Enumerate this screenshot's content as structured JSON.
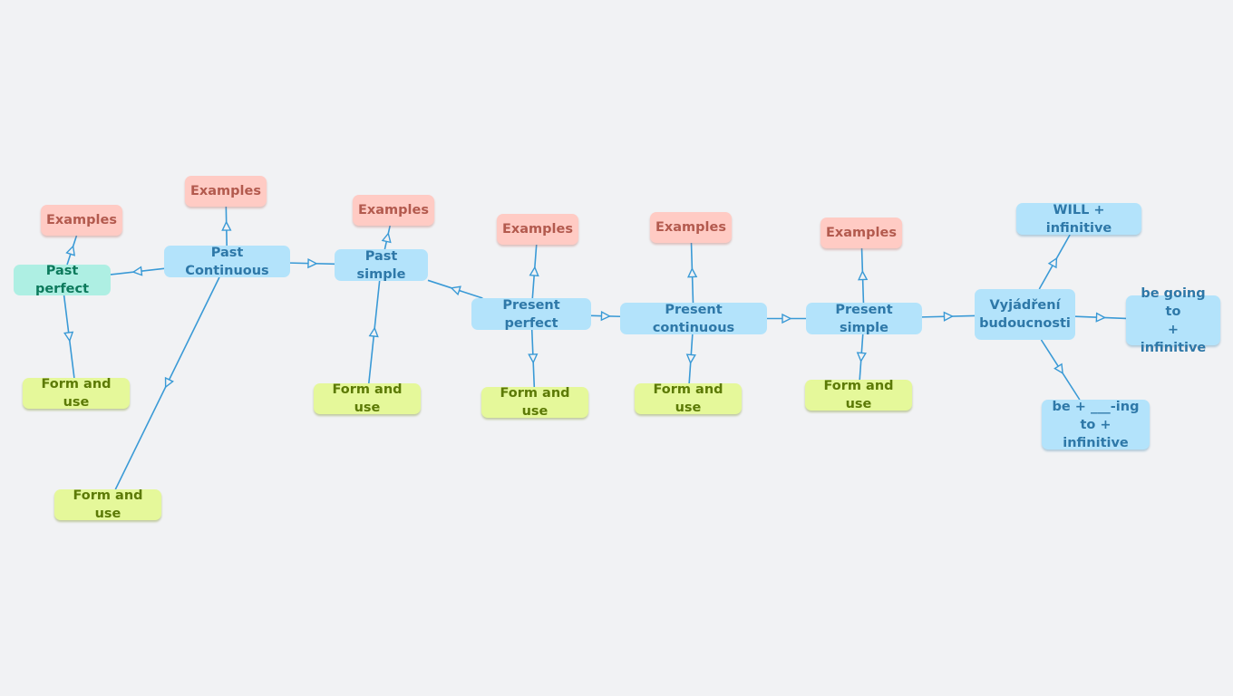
{
  "diagram": {
    "type": "concept-map",
    "colors": {
      "background": "#f1f2f4",
      "edge": "#3a9ad6",
      "topic": "#b3e3fb",
      "topic_text": "#2e78a8",
      "past_perfect": "#aeefe3",
      "past_perfect_text": "#0d7a5c",
      "examples": "#ffcbc4",
      "examples_text": "#b35a4e",
      "form_and_use": "#e5f89a",
      "form_and_use_text": "#5c7a06"
    },
    "nodes": [
      {
        "id": "past-perfect",
        "label": "Past perfect",
        "kind": "past-perfect"
      },
      {
        "id": "past-perfect-examples",
        "label": "Examples",
        "kind": "example"
      },
      {
        "id": "past-perfect-form",
        "label": "Form and use",
        "kind": "form"
      },
      {
        "id": "past-continuous",
        "label": "Past Continuous",
        "kind": "topic"
      },
      {
        "id": "past-continuous-examples",
        "label": "Examples",
        "kind": "example"
      },
      {
        "id": "past-continuous-form",
        "label": "Form and use",
        "kind": "form"
      },
      {
        "id": "past-simple",
        "label": "Past simple",
        "kind": "topic"
      },
      {
        "id": "past-simple-examples",
        "label": "Examples",
        "kind": "example"
      },
      {
        "id": "past-simple-form",
        "label": "Form and use",
        "kind": "form"
      },
      {
        "id": "present-perfect",
        "label": "Present perfect",
        "kind": "topic"
      },
      {
        "id": "present-perfect-examples",
        "label": "Examples",
        "kind": "example"
      },
      {
        "id": "present-perfect-form",
        "label": "Form and use",
        "kind": "form"
      },
      {
        "id": "present-continuous",
        "label": "Present continuous",
        "kind": "topic"
      },
      {
        "id": "present-continuous-examples",
        "label": "Examples",
        "kind": "example"
      },
      {
        "id": "present-continuous-form",
        "label": "Form and use",
        "kind": "form"
      },
      {
        "id": "present-simple",
        "label": "Present simple",
        "kind": "topic"
      },
      {
        "id": "present-simple-examples",
        "label": "Examples",
        "kind": "example"
      },
      {
        "id": "present-simple-form",
        "label": "Form and use",
        "kind": "form"
      },
      {
        "id": "future",
        "label": "Vyjádření\nbudoucnosti",
        "kind": "topic"
      },
      {
        "id": "will-infinitive",
        "label": "WILL + infinitive",
        "kind": "sub"
      },
      {
        "id": "be-going-to",
        "label": "be going to\n+ infinitive",
        "kind": "sub"
      },
      {
        "id": "be-ing-to",
        "label": "be + ___-ing\nto + infinitive",
        "kind": "sub"
      }
    ],
    "edges": [
      {
        "from": "past-continuous",
        "to": "past-perfect"
      },
      {
        "from": "past-perfect",
        "to": "past-perfect-examples"
      },
      {
        "from": "past-perfect",
        "to": "past-perfect-form"
      },
      {
        "from": "past-continuous",
        "to": "past-continuous-examples"
      },
      {
        "from": "past-continuous",
        "to": "past-continuous-form"
      },
      {
        "from": "past-continuous",
        "to": "past-simple"
      },
      {
        "from": "past-simple",
        "to": "past-simple-examples"
      },
      {
        "from": "past-simple-form",
        "to": "past-simple"
      },
      {
        "from": "present-perfect",
        "to": "past-simple"
      },
      {
        "from": "present-perfect",
        "to": "present-perfect-examples"
      },
      {
        "from": "present-perfect",
        "to": "present-perfect-form"
      },
      {
        "from": "present-perfect",
        "to": "present-continuous"
      },
      {
        "from": "present-continuous",
        "to": "present-continuous-examples"
      },
      {
        "from": "present-continuous",
        "to": "present-continuous-form"
      },
      {
        "from": "present-continuous",
        "to": "present-simple"
      },
      {
        "from": "present-simple",
        "to": "present-simple-examples"
      },
      {
        "from": "present-simple",
        "to": "present-simple-form"
      },
      {
        "from": "present-simple",
        "to": "future"
      },
      {
        "from": "future",
        "to": "will-infinitive"
      },
      {
        "from": "future",
        "to": "be-going-to"
      },
      {
        "from": "future",
        "to": "be-ing-to"
      }
    ]
  }
}
